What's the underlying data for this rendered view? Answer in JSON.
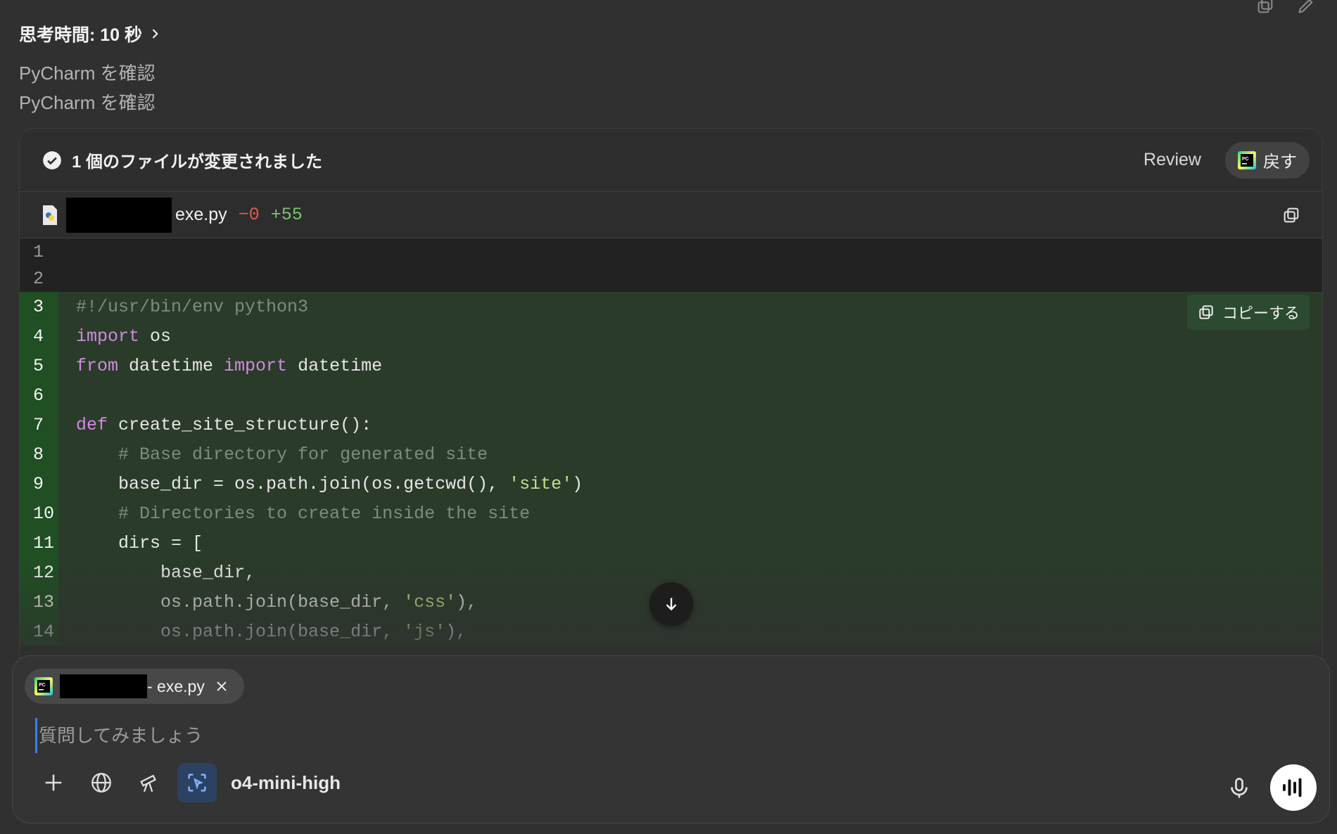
{
  "header": {
    "thinking_label": "思考時間: 10 秒",
    "status_lines": [
      "PyCharm を確認",
      "PyCharm を確認"
    ]
  },
  "changes_panel": {
    "files_changed_label": "1 個のファイルが変更されました",
    "review_label": "Review",
    "revert_label": "戻す",
    "file": {
      "name": "exe.py",
      "deletions": "−0",
      "additions": "+55"
    },
    "copy_label": "コピーする",
    "code_lines": [
      {
        "num": "1",
        "text": ""
      },
      {
        "num": "2",
        "text": ""
      },
      {
        "num": "3",
        "text": "#!/usr/bin/env python3"
      },
      {
        "num": "4",
        "text": "import os"
      },
      {
        "num": "5",
        "text": "from datetime import datetime"
      },
      {
        "num": "6",
        "text": ""
      },
      {
        "num": "7",
        "text": "def create_site_structure():"
      },
      {
        "num": "8",
        "text": "    # Base directory for generated site"
      },
      {
        "num": "9",
        "text": "    base_dir = os.path.join(os.getcwd(), 'site')"
      },
      {
        "num": "10",
        "text": "    # Directories to create inside the site"
      },
      {
        "num": "11",
        "text": "    dirs = ["
      },
      {
        "num": "12",
        "text": "        base_dir,"
      },
      {
        "num": "13",
        "text": "        os.path.join(base_dir, 'css'),"
      },
      {
        "num": "14",
        "text": "        os.path.join(base_dir, 'js'),"
      }
    ]
  },
  "composer": {
    "attachment_name": "- exe.py",
    "placeholder": "質問してみましょう",
    "model_label": "o4-mini-high",
    "tools": [
      "plus-icon",
      "globe-icon",
      "telescope-icon",
      "screen-select-icon"
    ]
  },
  "colors": {
    "background": "#303030",
    "added_line_bg": "#2a3b2a",
    "added_gutter_bg": "#1f4f23",
    "keyword": "#d18ae0",
    "comment": "#808a80",
    "string": "#c4dd8a",
    "deletions": "#e05a4f",
    "additions": "#7cc173",
    "active_tool": "#2b4262"
  }
}
